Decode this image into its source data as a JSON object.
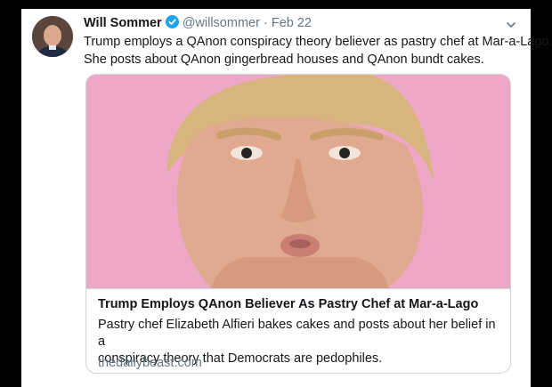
{
  "tweet": {
    "author_name": "Will Sommer",
    "handle": "@willsommer",
    "separator": "·",
    "date": "Feb 22",
    "text_lines": [
      "Trump employs a QAnon conspiracy theory believer as pastry chef at Mar-a-Lago.",
      "She posts about QAnon gingerbread houses and QAnon bundt cakes."
    ],
    "icons": {
      "verified": "verified-badge-icon",
      "menu": "chevron-down-icon"
    }
  },
  "card": {
    "title": "Trump Employs QAnon Believer As Pastry Chef at Mar-a-Lago",
    "description_lines": [
      "Pastry chef Elizabeth Alfieri bakes cakes and posts about her belief in a",
      "conspiracy theory that Democrats are pedophiles."
    ],
    "domain": "thedailybeast.com"
  },
  "colors": {
    "verified_blue": "#1da1f2",
    "secondary_text": "#657786",
    "primary_text": "#14171a",
    "card_image_background": "#efa7c7"
  }
}
